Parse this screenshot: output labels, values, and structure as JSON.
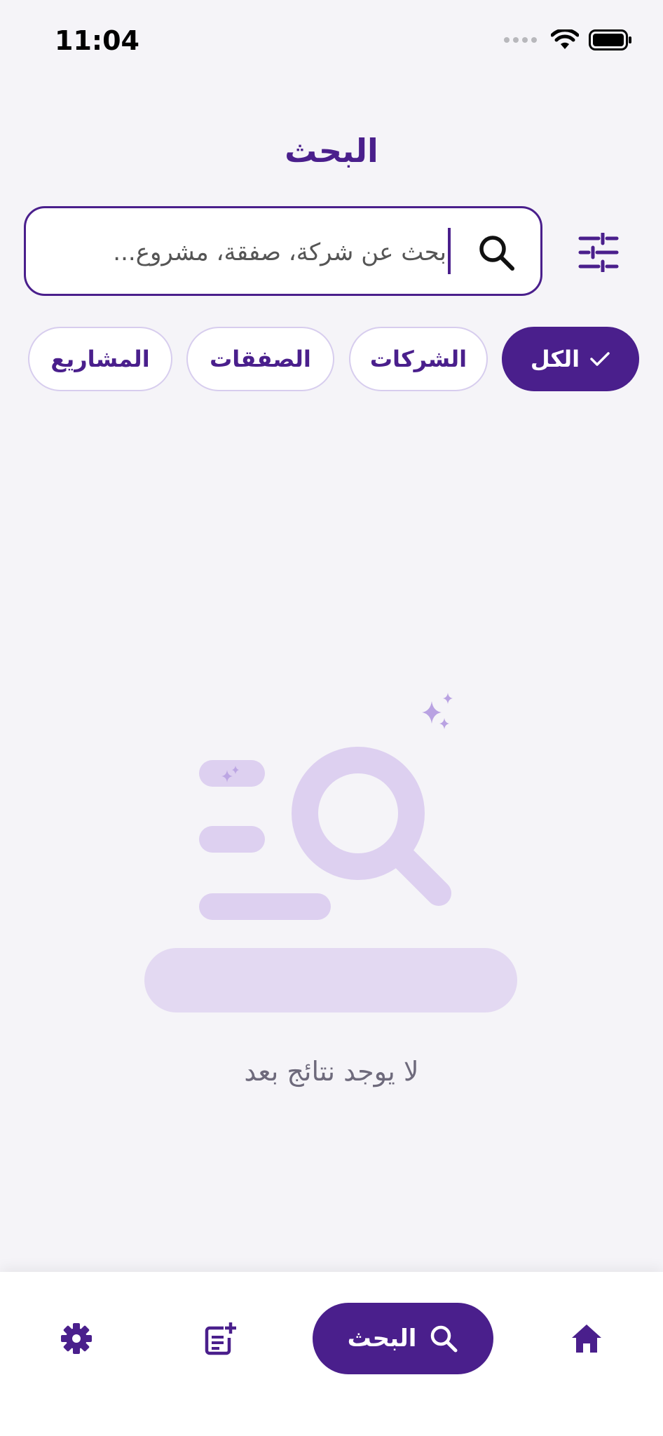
{
  "status_bar": {
    "time": "11:04"
  },
  "header": {
    "title": "البحث"
  },
  "search": {
    "placeholder": "بحث عن شركة، صفقة، مشروع..."
  },
  "filters": [
    {
      "label": "الكل",
      "selected": true
    },
    {
      "label": "الشركات",
      "selected": false
    },
    {
      "label": "الصفقات",
      "selected": false
    },
    {
      "label": "المشاريع",
      "selected": false
    }
  ],
  "empty_state": {
    "message": "لا يوجد نتائج بعد"
  },
  "bottom_nav": {
    "search_label": "البحث"
  },
  "colors": {
    "primary": "#4a1f8c",
    "chip_border": "#d7cdee",
    "illustration": "#ddd0f0",
    "background": "#f5f4f8"
  },
  "icons": [
    "wifi-icon",
    "battery-icon",
    "search-icon",
    "filter-sliders-icon",
    "check-icon",
    "sparkle-icon",
    "home-icon",
    "add-note-icon",
    "gear-icon"
  ]
}
